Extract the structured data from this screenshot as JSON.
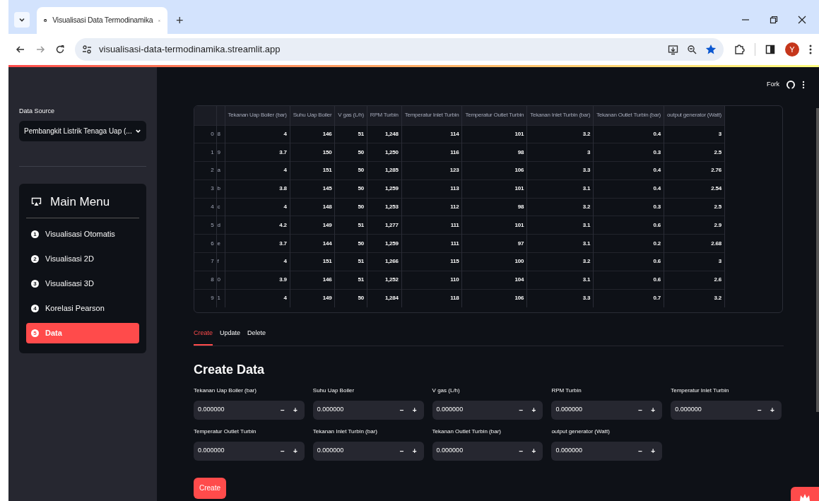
{
  "browser": {
    "tabs": [
      {
        "title": "Visualisasi Data Termodinamika",
        "selected": true
      }
    ],
    "new_tab": "+",
    "url": "visualisasi-data-termodinamika.streamlit.app",
    "avatar": "Y"
  },
  "header": {
    "fork": "Fork"
  },
  "sidebar": {
    "data_source": {
      "label": "Data Source",
      "value": "Pembangkit Listrik Tenaga Uap (..."
    },
    "menu": {
      "title": "Main Menu",
      "items": [
        {
          "number": "1",
          "label": "Visualisasi Otomatis",
          "selected": false
        },
        {
          "number": "2",
          "label": "Visualisasi 2D",
          "selected": false
        },
        {
          "number": "3",
          "label": "Visualisasi 3D",
          "selected": false
        },
        {
          "number": "4",
          "label": "Korelasi Pearson",
          "selected": false
        },
        {
          "number": "5",
          "label": "Data",
          "selected": true
        }
      ]
    }
  },
  "table": {
    "columns": [
      "Tekanan Uap Boiler (bar)",
      "Suhu Uap Boiler",
      "V gas (L/h)",
      "RPM Turbin",
      "Temperatur Inlet Turbin",
      "Temperatur Outlet Turbin",
      "Tekanan Inlet Turbin (bar)",
      "Tekanan Outlet Turbin (bar)",
      "output generator (Watt)"
    ],
    "rows": [
      {
        "index": "0",
        "id": "8",
        "cells": [
          "4",
          "146",
          "51",
          "1,248",
          "114",
          "101",
          "3.2",
          "0.4",
          "3"
        ]
      },
      {
        "index": "1",
        "id": "9",
        "cells": [
          "3.7",
          "150",
          "50",
          "1,250",
          "116",
          "98",
          "3",
          "0.3",
          "2.5"
        ]
      },
      {
        "index": "2",
        "id": "a",
        "cells": [
          "4",
          "151",
          "50",
          "1,285",
          "123",
          "106",
          "3.3",
          "0.4",
          "2.76"
        ]
      },
      {
        "index": "3",
        "id": "b",
        "cells": [
          "3.8",
          "145",
          "50",
          "1,259",
          "113",
          "101",
          "3.1",
          "0.4",
          "2.54"
        ]
      },
      {
        "index": "4",
        "id": "c",
        "cells": [
          "4",
          "148",
          "50",
          "1,253",
          "112",
          "98",
          "3.2",
          "0.3",
          "2.5"
        ]
      },
      {
        "index": "5",
        "id": "d",
        "cells": [
          "4.2",
          "149",
          "51",
          "1,277",
          "111",
          "101",
          "3.1",
          "0.6",
          "2.9"
        ]
      },
      {
        "index": "6",
        "id": "e",
        "cells": [
          "3.7",
          "144",
          "50",
          "1,259",
          "111",
          "97",
          "3.1",
          "0.2",
          "2.68"
        ]
      },
      {
        "index": "7",
        "id": "f",
        "cells": [
          "4",
          "151",
          "51",
          "1,266",
          "115",
          "100",
          "3.2",
          "0.6",
          "3"
        ]
      },
      {
        "index": "8",
        "id": "0",
        "cells": [
          "3.9",
          "146",
          "51",
          "1,252",
          "110",
          "104",
          "3.1",
          "0.6",
          "2.6"
        ]
      },
      {
        "index": "9",
        "id": "1",
        "cells": [
          "4",
          "149",
          "50",
          "1,284",
          "118",
          "106",
          "3.3",
          "0.7",
          "3.2"
        ]
      }
    ]
  },
  "tabs": [
    {
      "label": "Create",
      "selected": true
    },
    {
      "label": "Update",
      "selected": false
    },
    {
      "label": "Delete",
      "selected": false
    }
  ],
  "form": {
    "title": "Create Data",
    "fields": [
      {
        "label": "Tekanan Uap Boiler (bar)",
        "value": "0.000000",
        "minus": "−",
        "plus": "+"
      },
      {
        "label": "Suhu Uap Boiler",
        "value": "0.000000",
        "minus": "−",
        "plus": "+"
      },
      {
        "label": "V gas (L/h)",
        "value": "0.000000",
        "minus": "−",
        "plus": "+"
      },
      {
        "label": "RPM Turbin",
        "value": "0.000000",
        "minus": "−",
        "plus": "+"
      },
      {
        "label": "Temperatur Inlet Turbin",
        "value": "0.000000",
        "minus": "−",
        "plus": "+"
      },
      {
        "label": "Temperatur Outlet Turbin",
        "value": "0.000000",
        "minus": "−",
        "plus": "+"
      },
      {
        "label": "Tekanan Inlet Turbin (bar)",
        "value": "0.000000",
        "minus": "−",
        "plus": "+"
      },
      {
        "label": "Tekanan Outlet Turbin (bar)",
        "value": "0.000000",
        "minus": "−",
        "plus": "+"
      },
      {
        "label": "output generator (Watt)",
        "value": "0.000000",
        "minus": "−",
        "plus": "+"
      }
    ],
    "submit": "Create"
  }
}
